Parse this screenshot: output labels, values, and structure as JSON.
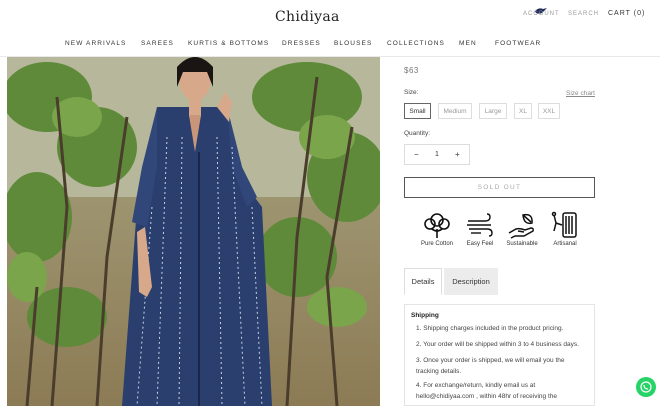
{
  "header": {
    "logo_text": "Chidiyaa",
    "account": "ACCOUNT",
    "search": "SEARCH",
    "cart": "CART (0)"
  },
  "nav": [
    "NEW ARRIVALS",
    "SAREES",
    "KURTIS & BOTTOMS",
    "DRESSES",
    "BLOUSES",
    "COLLECTIONS",
    "MEN",
    "FOOTWEAR"
  ],
  "product": {
    "price": "$63",
    "size_label": "Size:",
    "size_chart": "Size chart",
    "sizes": [
      "Small",
      "Medium",
      "Large",
      "XL",
      "XXL"
    ],
    "selected_size": "Small",
    "quantity_label": "Quantity:",
    "quantity_value": "1",
    "minus": "−",
    "plus": "+",
    "sold_out": "SOLD OUT"
  },
  "features": [
    {
      "label": "Pure Cotton",
      "icon": "cotton-flower-icon"
    },
    {
      "label": "Easy Feel",
      "icon": "wind-icon"
    },
    {
      "label": "Sustainable",
      "icon": "hand-leaf-icon"
    },
    {
      "label": "Artisanal",
      "icon": "spool-icon"
    }
  ],
  "tabs": [
    "Details",
    "Description"
  ],
  "active_tab": "Details",
  "details": {
    "title": "Shipping",
    "items": [
      "1. Shipping charges included in the product pricing.",
      "2. Your order will be shipped within 3 to 4 business days.",
      "3. Once your order is shipped, we will email you the tracking details.",
      "4. For exchange/return, kindly email us at hello@chidiyaa.com , within 48hr of receiving the"
    ]
  },
  "colors": {
    "whatsapp": "#25d366",
    "dress_indigo": "#2b3f6e"
  }
}
